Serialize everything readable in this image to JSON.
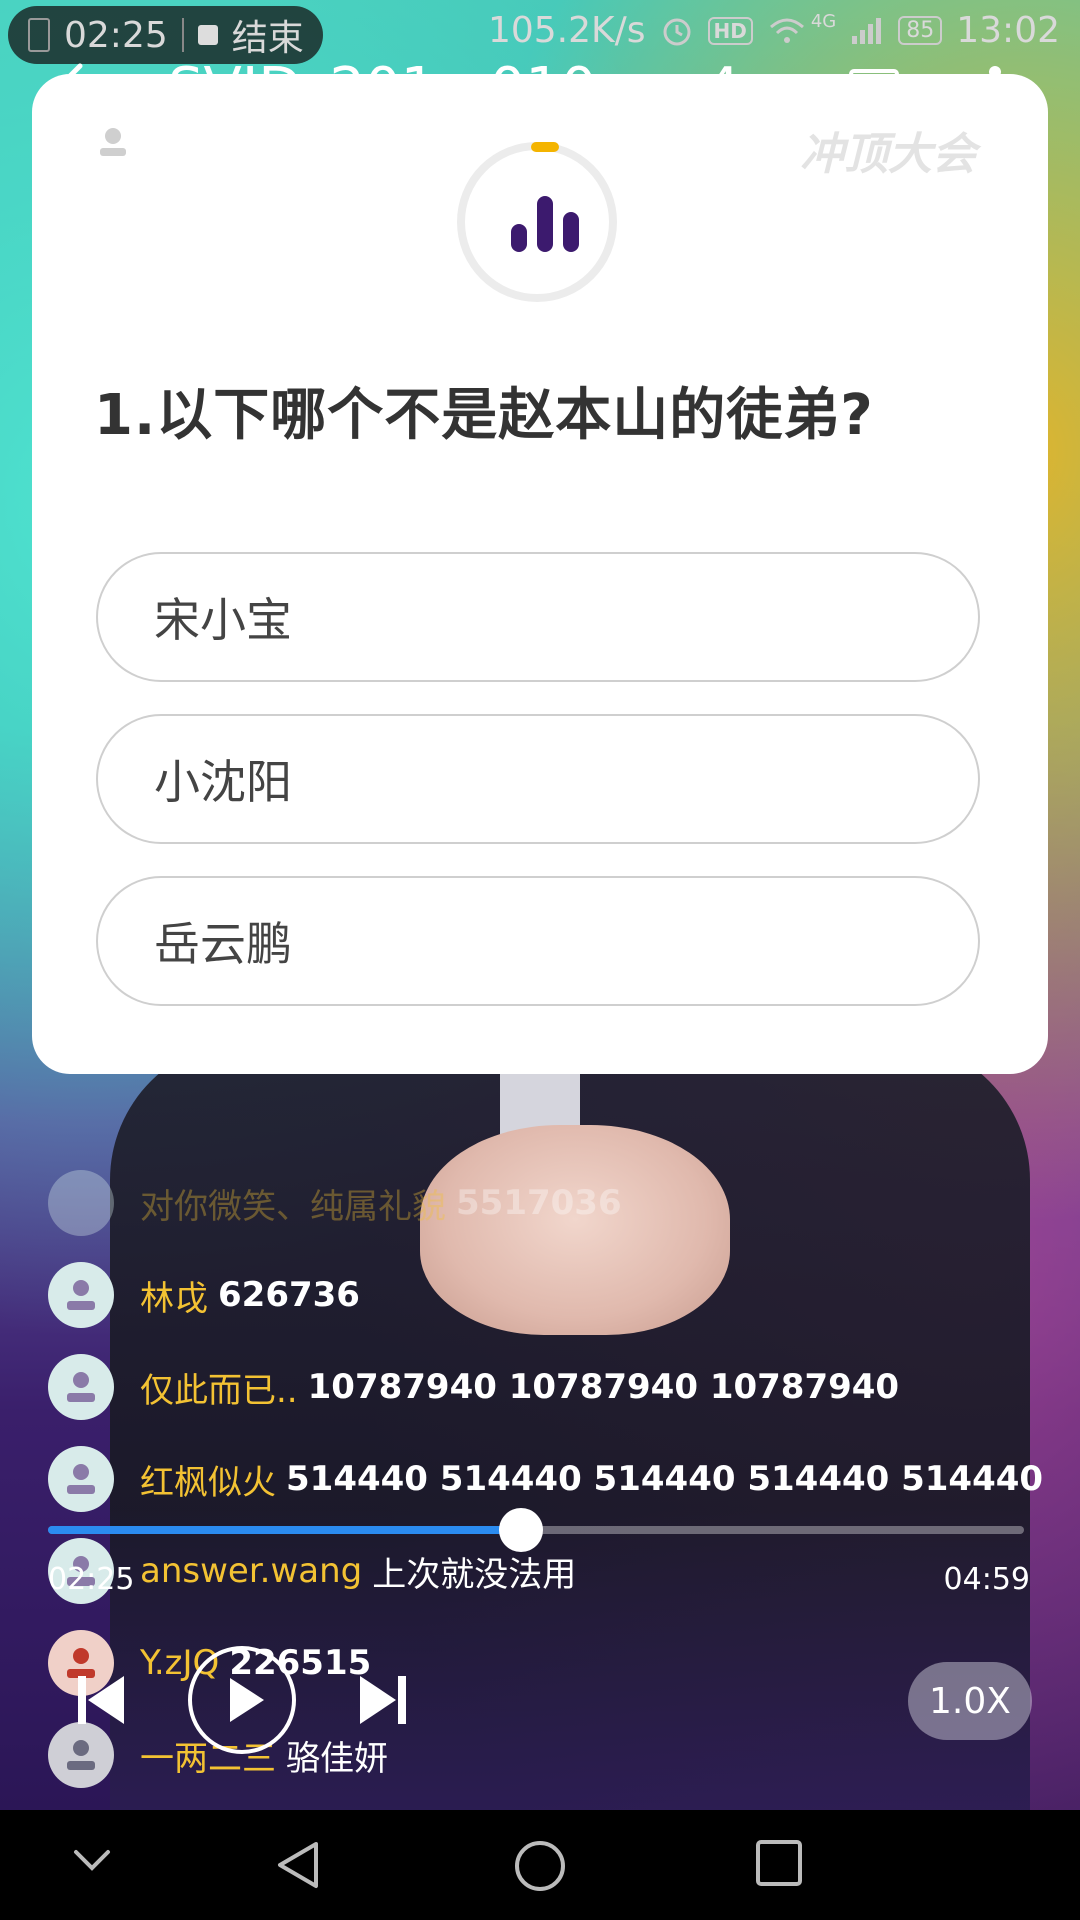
{
  "status_bar": {
    "left_time": "02:25",
    "stop_label": "结束",
    "net_speed": "105.2K/s",
    "hd": "HD",
    "network": "4G",
    "battery": "85",
    "clock": "13:02"
  },
  "video": {
    "title": "SVID_201...010.mp4"
  },
  "quiz": {
    "brand": "冲顶大会",
    "question": "1.以下哪个不是赵本山的徒弟?",
    "options": [
      "宋小宝",
      "小沈阳",
      "岳云鹏"
    ]
  },
  "comments": [
    {
      "name": "对你微笑、纯属礼貌",
      "text": "5517036"
    },
    {
      "name": "林戉",
      "text": "626736"
    },
    {
      "name": "仅此而已..",
      "text": "10787940  10787940   10787940"
    },
    {
      "name": "红枫似火",
      "text": "514440 514440 514440 514440 514440"
    },
    {
      "name": "answer.wang",
      "text": "上次就没法用"
    },
    {
      "name": "Y.zJQ",
      "text": "226515"
    },
    {
      "name": "一两二三",
      "text": "骆佳妍"
    }
  ],
  "player": {
    "current_time": "02:25",
    "total_time": "04:59",
    "progress": 0.485,
    "speed": "1.0X"
  },
  "colors": {
    "accent_progress": "#2b8cf0",
    "comment_name": "#f3c233",
    "timer_arc": "#f4b400",
    "quiz_icon": "#3c1a6e"
  }
}
